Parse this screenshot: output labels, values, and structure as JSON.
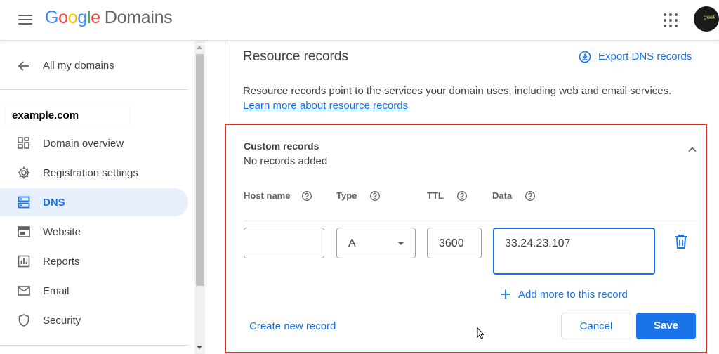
{
  "header": {
    "logo_google": [
      "G",
      "o",
      "o",
      "g",
      "l",
      "e"
    ],
    "logo_product": "Domains",
    "menu_icon": "hamburger-menu-icon",
    "apps_icon": "apps-grid-icon",
    "avatar_text": "geek"
  },
  "sidebar": {
    "back_label": "All my domains",
    "domain": "example.com",
    "items": [
      {
        "label": "Domain overview",
        "icon": "dashboard-icon",
        "active": false
      },
      {
        "label": "Registration settings",
        "icon": "gear-icon",
        "active": false
      },
      {
        "label": "DNS",
        "icon": "dns-server-icon",
        "active": true
      },
      {
        "label": "Website",
        "icon": "web-browser-icon",
        "active": false
      },
      {
        "label": "Reports",
        "icon": "bar-chart-icon",
        "active": false
      },
      {
        "label": "Email",
        "icon": "mail-icon",
        "active": false
      },
      {
        "label": "Security",
        "icon": "shield-icon",
        "active": false
      }
    ]
  },
  "main": {
    "title": "Resource records",
    "export_label": "Export DNS records",
    "description": "Resource records point to the services your domain uses, including web and email services.",
    "learn_more": "Learn more about resource records",
    "custom_records": {
      "title": "Custom records",
      "subtitle": "No records added",
      "columns": [
        "Host name",
        "Type",
        "TTL",
        "Data"
      ],
      "row": {
        "host_name": "",
        "type": "A",
        "ttl": "3600",
        "data": "33.24.23.107"
      },
      "add_more": "Add more to this record",
      "create_new": "Create new record",
      "cancel": "Cancel",
      "save": "Save"
    }
  },
  "colors": {
    "accent": "#1a73e8",
    "highlight_border": "#d93025",
    "active_nav_bg": "#e8f0fe"
  }
}
